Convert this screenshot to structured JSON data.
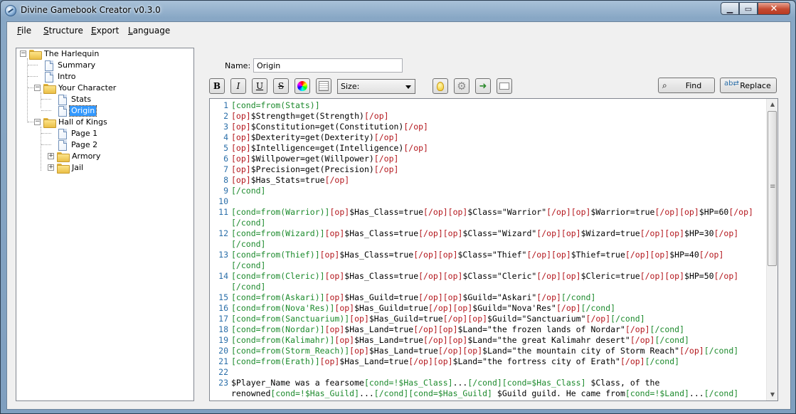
{
  "window": {
    "title": "Divine Gamebook Creator v0.3.0"
  },
  "menu": {
    "items": [
      {
        "first": "F",
        "rest": "ile"
      },
      {
        "first": "S",
        "rest": "tructure"
      },
      {
        "first": "E",
        "rest": "xport"
      },
      {
        "first": "L",
        "rest": "anguage"
      }
    ]
  },
  "tree": {
    "nodes": [
      {
        "label": "The Harlequin",
        "type": "folder-open",
        "depth": 0,
        "expanded": true
      },
      {
        "label": "Summary",
        "type": "document",
        "depth": 1
      },
      {
        "label": "Intro",
        "type": "document",
        "depth": 1
      },
      {
        "label": "Your Character",
        "type": "folder-open",
        "depth": 1,
        "expanded": true
      },
      {
        "label": "Stats",
        "type": "document",
        "depth": 2
      },
      {
        "label": "Origin",
        "type": "document",
        "depth": 2,
        "selected": true
      },
      {
        "label": "Hall of Kings",
        "type": "folder-open",
        "depth": 1,
        "expanded": true
      },
      {
        "label": "Page 1",
        "type": "document",
        "depth": 2
      },
      {
        "label": "Page 2",
        "type": "document",
        "depth": 2
      },
      {
        "label": "Armory",
        "type": "folder",
        "depth": 2,
        "expanded": false
      },
      {
        "label": "Jail",
        "type": "folder",
        "depth": 2,
        "expanded": false
      }
    ]
  },
  "editor": {
    "name_label": "Name:",
    "name_value": "Origin",
    "toolbar": {
      "bold": "B",
      "italic": "I",
      "underline": "U",
      "strike": "S",
      "size_label": "Size:",
      "find_label": "Find",
      "replace_label": "Replace"
    },
    "lines": [
      {
        "n": "1",
        "parts": [
          [
            "c",
            "[cond=from(Stats)]"
          ]
        ]
      },
      {
        "n": "2",
        "parts": [
          [
            "o",
            "[op]"
          ],
          [
            "t",
            "$Strength=get(Strength)"
          ],
          [
            "o",
            "[/op]"
          ]
        ]
      },
      {
        "n": "3",
        "parts": [
          [
            "o",
            "[op]"
          ],
          [
            "t",
            "$Constitution=get(Constitution)"
          ],
          [
            "o",
            "[/op]"
          ]
        ]
      },
      {
        "n": "4",
        "parts": [
          [
            "o",
            "[op]"
          ],
          [
            "t",
            "$Dexterity=get(Dexterity)"
          ],
          [
            "o",
            "[/op]"
          ]
        ]
      },
      {
        "n": "5",
        "parts": [
          [
            "o",
            "[op]"
          ],
          [
            "t",
            "$Intelligence=get(Intelligence)"
          ],
          [
            "o",
            "[/op]"
          ]
        ]
      },
      {
        "n": "6",
        "parts": [
          [
            "o",
            "[op]"
          ],
          [
            "t",
            "$Willpower=get(Willpower)"
          ],
          [
            "o",
            "[/op]"
          ]
        ]
      },
      {
        "n": "7",
        "parts": [
          [
            "o",
            "[op]"
          ],
          [
            "t",
            "$Precision=get(Precision)"
          ],
          [
            "o",
            "[/op]"
          ]
        ]
      },
      {
        "n": "8",
        "parts": [
          [
            "o",
            "[op]"
          ],
          [
            "t",
            "$Has_Stats=true"
          ],
          [
            "o",
            "[/op]"
          ]
        ]
      },
      {
        "n": "9",
        "parts": [
          [
            "c",
            "[/cond]"
          ]
        ]
      },
      {
        "n": "10",
        "parts": []
      },
      {
        "n": "11",
        "parts": [
          [
            "c",
            "[cond=from(Warrior)]"
          ],
          [
            "o",
            "[op]"
          ],
          [
            "t",
            "$Has_Class=true"
          ],
          [
            "o",
            "[/op][op]"
          ],
          [
            "t",
            "$Class=\"Warrior\""
          ],
          [
            "o",
            "[/op][op]"
          ],
          [
            "t",
            "$Warrior=true"
          ],
          [
            "o",
            "[/op][op]"
          ],
          [
            "t",
            "$HP=60"
          ],
          [
            "o",
            "[/op]"
          ]
        ]
      },
      {
        "n": "",
        "parts": [
          [
            "c",
            "[/cond]"
          ]
        ]
      },
      {
        "n": "12",
        "parts": [
          [
            "c",
            "[cond=from(Wizard)]"
          ],
          [
            "o",
            "[op]"
          ],
          [
            "t",
            "$Has_Class=true"
          ],
          [
            "o",
            "[/op][op]"
          ],
          [
            "t",
            "$Class=\"Wizard\""
          ],
          [
            "o",
            "[/op][op]"
          ],
          [
            "t",
            "$Wizard=true"
          ],
          [
            "o",
            "[/op][op]"
          ],
          [
            "t",
            "$HP=30"
          ],
          [
            "o",
            "[/op]"
          ]
        ]
      },
      {
        "n": "",
        "parts": [
          [
            "c",
            "[/cond]"
          ]
        ]
      },
      {
        "n": "13",
        "parts": [
          [
            "c",
            "[cond=from(Thief)]"
          ],
          [
            "o",
            "[op]"
          ],
          [
            "t",
            "$Has_Class=true"
          ],
          [
            "o",
            "[/op][op]"
          ],
          [
            "t",
            "$Class=\"Thief\""
          ],
          [
            "o",
            "[/op][op]"
          ],
          [
            "t",
            "$Thief=true"
          ],
          [
            "o",
            "[/op][op]"
          ],
          [
            "t",
            "$HP=40"
          ],
          [
            "o",
            "[/op]"
          ]
        ]
      },
      {
        "n": "",
        "parts": [
          [
            "c",
            "[/cond]"
          ]
        ]
      },
      {
        "n": "14",
        "parts": [
          [
            "c",
            "[cond=from(Cleric)]"
          ],
          [
            "o",
            "[op]"
          ],
          [
            "t",
            "$Has_Class=true"
          ],
          [
            "o",
            "[/op][op]"
          ],
          [
            "t",
            "$Class=\"Cleric\""
          ],
          [
            "o",
            "[/op][op]"
          ],
          [
            "t",
            "$Cleric=true"
          ],
          [
            "o",
            "[/op][op]"
          ],
          [
            "t",
            "$HP=50"
          ],
          [
            "o",
            "[/op]"
          ]
        ]
      },
      {
        "n": "",
        "parts": [
          [
            "c",
            "[/cond]"
          ]
        ]
      },
      {
        "n": "15",
        "parts": [
          [
            "c",
            "[cond=from(Askari)]"
          ],
          [
            "o",
            "[op]"
          ],
          [
            "t",
            "$Has_Guild=true"
          ],
          [
            "o",
            "[/op][op]"
          ],
          [
            "t",
            "$Guild=\"Askari\""
          ],
          [
            "o",
            "[/op]"
          ],
          [
            "c",
            "[/cond]"
          ]
        ]
      },
      {
        "n": "16",
        "parts": [
          [
            "c",
            "[cond=from(Nova'Res)]"
          ],
          [
            "o",
            "[op]"
          ],
          [
            "t",
            "$Has_Guild=true"
          ],
          [
            "o",
            "[/op][op]"
          ],
          [
            "t",
            "$Guild=\"Nova'Res\""
          ],
          [
            "o",
            "[/op]"
          ],
          [
            "c",
            "[/cond]"
          ]
        ]
      },
      {
        "n": "17",
        "parts": [
          [
            "c",
            "[cond=from(Sanctuarium)]"
          ],
          [
            "o",
            "[op]"
          ],
          [
            "t",
            "$Has_Guild=true"
          ],
          [
            "o",
            "[/op][op]"
          ],
          [
            "t",
            "$Guild=\"Sanctuarium\""
          ],
          [
            "o",
            "[/op]"
          ],
          [
            "c",
            "[/cond]"
          ]
        ]
      },
      {
        "n": "18",
        "parts": [
          [
            "c",
            "[cond=from(Nordar)]"
          ],
          [
            "o",
            "[op]"
          ],
          [
            "t",
            "$Has_Land=true"
          ],
          [
            "o",
            "[/op][op]"
          ],
          [
            "t",
            "$Land=\"the frozen lands of Nordar\""
          ],
          [
            "o",
            "[/op]"
          ],
          [
            "c",
            "[/cond]"
          ]
        ]
      },
      {
        "n": "19",
        "parts": [
          [
            "c",
            "[cond=from(Kalimahr)]"
          ],
          [
            "o",
            "[op]"
          ],
          [
            "t",
            "$Has_Land=true"
          ],
          [
            "o",
            "[/op][op]"
          ],
          [
            "t",
            "$Land=\"the great Kalimahr desert\""
          ],
          [
            "o",
            "[/op]"
          ],
          [
            "c",
            "[/cond]"
          ]
        ]
      },
      {
        "n": "20",
        "parts": [
          [
            "c",
            "[cond=from(Storm_Reach)]"
          ],
          [
            "o",
            "[op]"
          ],
          [
            "t",
            "$Has_Land=true"
          ],
          [
            "o",
            "[/op][op]"
          ],
          [
            "t",
            "$Land=\"the mountain city of Storm Reach\""
          ],
          [
            "o",
            "[/op]"
          ],
          [
            "c",
            "[/cond]"
          ]
        ]
      },
      {
        "n": "21",
        "parts": [
          [
            "c",
            "[cond=from(Erath)]"
          ],
          [
            "o",
            "[op]"
          ],
          [
            "t",
            "$Has_Land=true"
          ],
          [
            "o",
            "[/op][op]"
          ],
          [
            "t",
            "$Land=\"the fortress city of Erath\""
          ],
          [
            "o",
            "[/op]"
          ],
          [
            "c",
            "[/cond]"
          ]
        ]
      },
      {
        "n": "22",
        "parts": []
      },
      {
        "n": "23",
        "parts": [
          [
            "t",
            "$Player_Name was a fearsome"
          ],
          [
            "c",
            "[cond=!$Has_Class]"
          ],
          [
            "t",
            "..."
          ],
          [
            "c",
            "[/cond][cond=$Has_Class]"
          ],
          [
            "t",
            " $Class, of the"
          ]
        ]
      },
      {
        "n": "",
        "parts": [
          [
            "t",
            "renowned"
          ],
          [
            "c",
            "[cond=!$Has_Guild]"
          ],
          [
            "t",
            "..."
          ],
          [
            "c",
            "[/cond][cond=$Has_Guild]"
          ],
          [
            "t",
            " $Guild guild. He came from"
          ],
          [
            "c",
            "[cond=!$Land]"
          ],
          [
            "t",
            "..."
          ],
          [
            "c",
            "[/cond]"
          ]
        ]
      }
    ]
  },
  "colors": {
    "cond": "#1c8a2c",
    "op": "#b3161c",
    "line_number": "#2b6fa9",
    "selection": "#3399ff"
  }
}
